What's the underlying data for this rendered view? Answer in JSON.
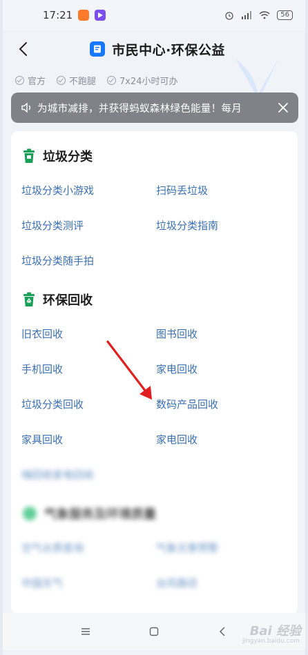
{
  "status_bar": {
    "time": "17:21",
    "battery": "56"
  },
  "header": {
    "title": "市民中心·环保公益"
  },
  "badges": [
    "官方",
    "不跑腿",
    "7x24小时可办"
  ],
  "notice": {
    "text": "为城市减排，并获得蚂蚁森林绿色能量！每月"
  },
  "sections": [
    {
      "title": "垃圾分类",
      "icon": "trash-bin-icon",
      "color": "#18a058",
      "items": [
        "垃圾分类小游戏",
        "扫码丢垃圾",
        "垃圾分类测评",
        "垃圾分类指南",
        "垃圾分类随手拍"
      ]
    },
    {
      "title": "环保回收",
      "icon": "recycle-bin-icon",
      "color": "#18a058",
      "items": [
        "旧衣回收",
        "图书回收",
        "手机回收",
        "家电回收",
        "垃圾分类回收",
        "数码产品回收",
        "家具回收",
        "家电回收",
        "嗨回收家电回收"
      ]
    },
    {
      "title": "气象服务及环境质量",
      "icon": "weather-icon",
      "color": "#2fbf7a",
      "items": [
        "空气水质查询",
        "气象灾害预警",
        "中国天气",
        "台风路径"
      ]
    }
  ],
  "watermark": {
    "brand": "Bai 经验",
    "sub": "jingyan.baidu.com"
  },
  "colors": {
    "link": "#3a6fb0",
    "accent": "#1677ff",
    "annotation": "#e02020"
  }
}
